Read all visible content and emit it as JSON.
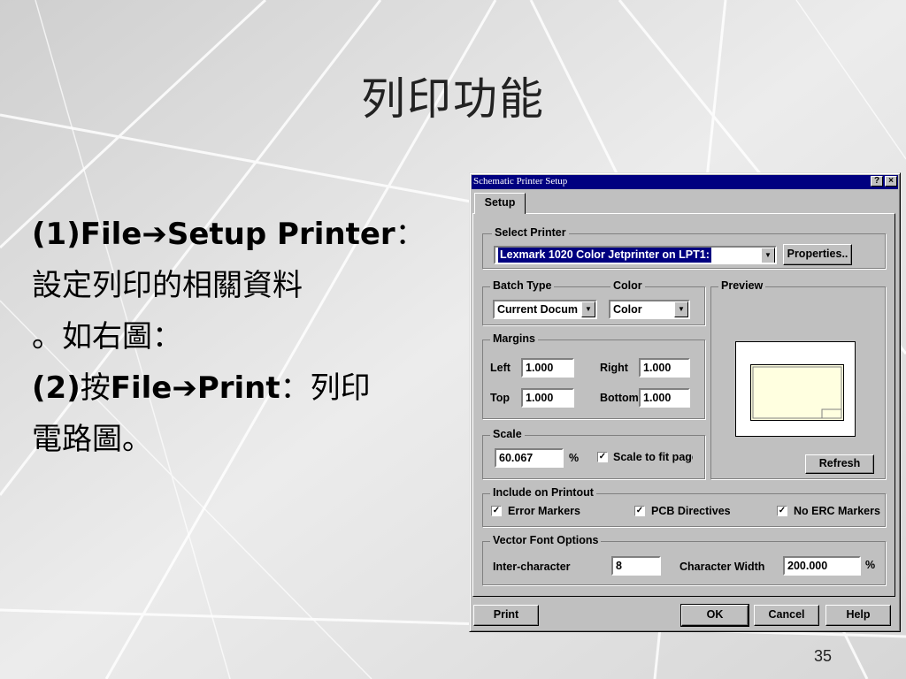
{
  "slide": {
    "title": "列印功能",
    "page_number": "35",
    "body": {
      "l1_a": "(1)File",
      "arrow": "➔",
      "l1_b": "Setup Printer",
      "l1_c": "：",
      "l2": "設定列印的相關資料",
      "l3": "。如右圖：",
      "l4_a": "(2)",
      "l4_b": "按",
      "l4_c": "File",
      "l4_d": "Print",
      "l4_e": "：列印",
      "l5": "電路圖。"
    }
  },
  "dialog": {
    "title": "Schematic Printer Setup",
    "help_btn": "?",
    "close_btn": "×",
    "tab_setup": "Setup",
    "select_printer": {
      "legend": "Select Printer",
      "value": "Lexmark 1020 Color Jetprinter on LPT1:",
      "properties_btn": "Properties.."
    },
    "batch_type": {
      "label": "Batch Type",
      "value": "Current Docum"
    },
    "color": {
      "label": "Color",
      "value": "Color"
    },
    "margins": {
      "legend": "Margins",
      "left_label": "Left",
      "left": "1.000",
      "right_label": "Right",
      "right": "1.000",
      "top_label": "Top",
      "top": "1.000",
      "bottom_label": "Bottom",
      "bottom": "1.000"
    },
    "scale": {
      "legend": "Scale",
      "value": "60.067",
      "unit": "%",
      "fit_label": "Scale to fit page",
      "fit_checked": true
    },
    "preview": {
      "legend": "Preview",
      "refresh_btn": "Refresh"
    },
    "include": {
      "legend": "Include on Printout",
      "error_markers": "Error Markers",
      "pcb_directives": "PCB Directives",
      "no_erc": "No ERC Markers",
      "check": "✓"
    },
    "vector_font": {
      "legend": "Vector Font Options",
      "inter_label": "Inter-character",
      "inter_value": "8",
      "width_label": "Character Width",
      "width_value": "200.000",
      "unit": "%"
    },
    "buttons": {
      "print": "Print",
      "ok": "OK",
      "cancel": "Cancel",
      "help": "Help"
    },
    "dropdown_arrow": "▼"
  }
}
